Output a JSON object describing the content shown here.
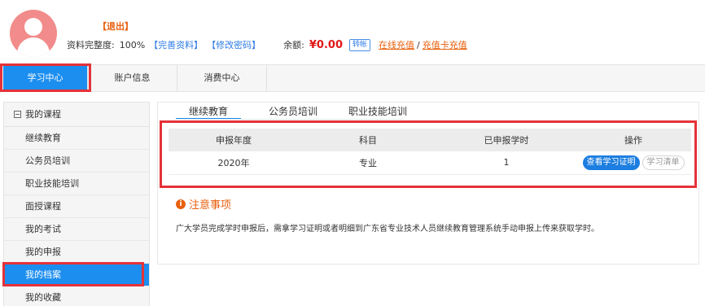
{
  "profile": {
    "logout_label": "【退出】",
    "completeness_label": "资料完整度:",
    "completeness_value": "100%",
    "complete_info_link": "【完善资料】",
    "change_password_link": "【修改密码】",
    "balance_label": "余额:",
    "balance_value": "¥0.00",
    "transfer_label": "转帐",
    "online_recharge_link": "在线充值",
    "slash": "/",
    "card_recharge_link": "充值卡充值"
  },
  "topnav": {
    "tabs": [
      {
        "label": "学习中心",
        "active": true
      },
      {
        "label": "账户信息",
        "active": false
      },
      {
        "label": "消费中心",
        "active": false
      }
    ]
  },
  "sidebar": {
    "header": "我的课程",
    "items": [
      {
        "label": "继续教育"
      },
      {
        "label": "公务员培训"
      },
      {
        "label": "职业技能培训"
      },
      {
        "label": "面授课程"
      },
      {
        "label": "我的考试"
      },
      {
        "label": "我的申报"
      },
      {
        "label": "我的档案",
        "active": true
      },
      {
        "label": "我的收藏"
      }
    ]
  },
  "subtabs": [
    {
      "label": "继续教育",
      "active": true
    },
    {
      "label": "公务员培训",
      "active": false
    },
    {
      "label": "职业技能培训",
      "active": false
    }
  ],
  "table": {
    "headers": [
      "申报年度",
      "科目",
      "已申报学时",
      "操作"
    ],
    "rows": [
      {
        "year": "2020年",
        "subject": "专业",
        "hours": "1",
        "btn_primary": "查看学习证明",
        "btn_secondary": "学习清单"
      }
    ]
  },
  "notice": {
    "title": "注意事项",
    "icon": "info-circle-icon",
    "text": "广大学员完成学时申报后，需拿学习证明或者明细到广东省专业技术人员继续教育管理系统手动申报上传来获取学时。"
  },
  "colors": {
    "accent": "#1c8ef0",
    "highlight_box": "#e53238",
    "link_orange": "#e8600f",
    "balance_red": "#e01818"
  }
}
